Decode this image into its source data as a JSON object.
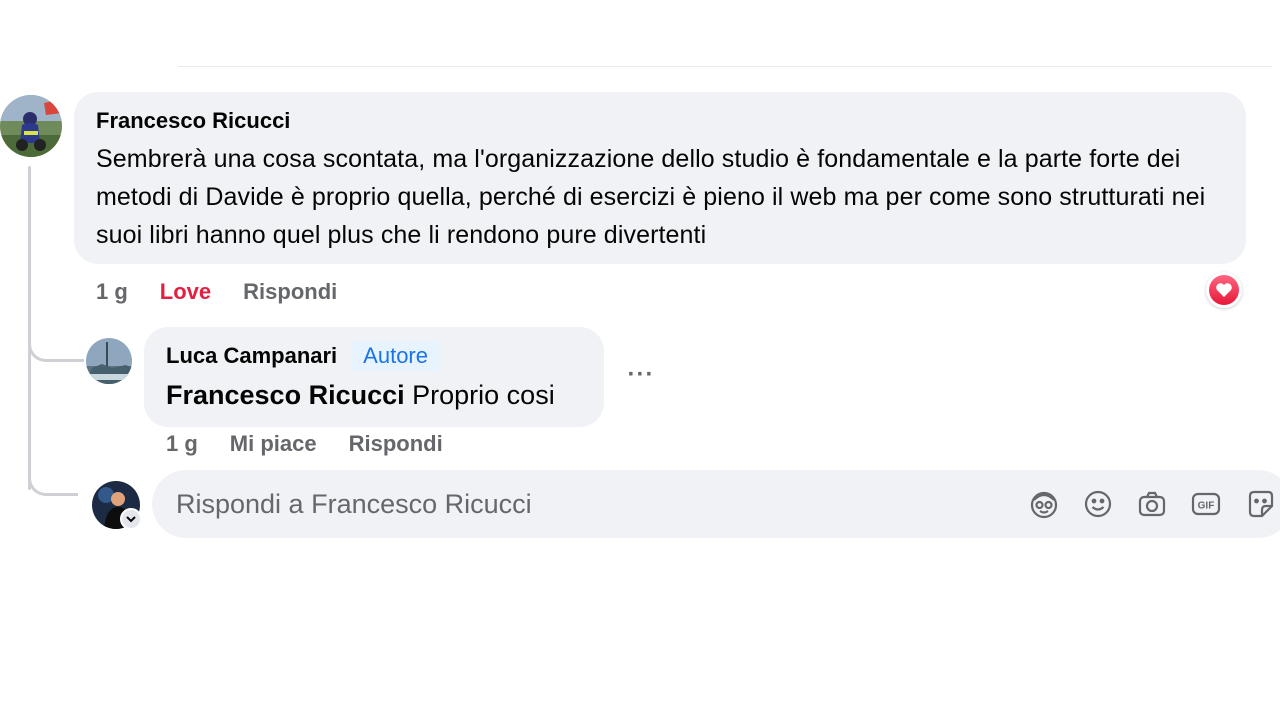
{
  "comment": {
    "author": "Francesco Ricucci",
    "text": "Sembrerà una cosa scontata, ma l'organizzazione dello studio è fondamentale e la parte forte dei metodi di Davide è proprio quella, perché di esercizi è pieno il web ma per come sono strutturati nei suoi libri hanno quel plus che li rendono pure divertenti",
    "time": "1 g",
    "like_label": "Love",
    "reply_label": "Rispondi",
    "reaction_icon": "love-heart-icon"
  },
  "reply": {
    "author": "Luca Campanari",
    "badge": "Autore",
    "mention": "Francesco Ricucci",
    "text": "Proprio cosi",
    "time": "1 g",
    "like_label": "Mi piace",
    "reply_label": "Rispondi",
    "more_label": "···"
  },
  "reply_input": {
    "placeholder": "Rispondi a Francesco Ricucci",
    "icons": [
      "avatar-sticker-icon",
      "emoji-icon",
      "camera-icon",
      "gif-icon",
      "sticker-icon"
    ]
  },
  "colors": {
    "bubble": "#f0f2f5",
    "love": "#e41e3f",
    "badge_text": "#1b74e4",
    "badge_bg": "#e7f3ff",
    "muted": "#65676b"
  }
}
